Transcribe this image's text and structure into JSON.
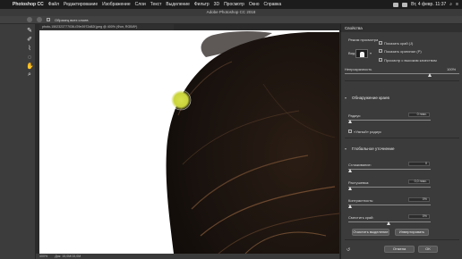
{
  "menubar": {
    "app": "Photoshop CC",
    "items": [
      "Файл",
      "Редактирование",
      "Изображение",
      "Слои",
      "Текст",
      "Выделение",
      "Фильтр",
      "3D",
      "Просмотр",
      "Окно",
      "Справка"
    ],
    "clock": "Вт, 4 февр.  11:37"
  },
  "window_title": "Adobe Photoshop CC 2018",
  "options": {
    "sample_all_layers": "Образец всех слоев"
  },
  "document": {
    "tab": "photo-1502323777036-f29e3972d82f.jpeg @ 400% (Фон, RGB/8*)",
    "zoom": "400%",
    "doc_info": "Док: 15,0M/15,0M"
  },
  "panel": {
    "title": "Свойства",
    "view_mode": "Режим просмотра",
    "view_label": "Вид:",
    "show_edge": "Показать край (J)",
    "show_original": "Показать оригинал (P)",
    "high_quality": "Просмотр с высоким качеством",
    "transparency_label": "Непрозрачность",
    "transparency_value": "100%",
    "edge_detection": "Обнаружение краев",
    "radius_label": "Радиус:",
    "radius_value": "0 пикс.",
    "smart_radius": "«Умный» радиус",
    "global_refinements": "Глобальное уточнение",
    "smooth_label": "Сглаживание:",
    "smooth_value": "0",
    "feather_label": "Растушевка:",
    "feather_value": "0,0 пикс.",
    "contrast_label": "Контрастность:",
    "contrast_value": "0%",
    "shift_label": "Сместить край:",
    "shift_value": "0%",
    "clear_selection": "Очистить выделение",
    "invert": "Инвертировать",
    "cancel": "Отмена",
    "ok": "OK"
  }
}
